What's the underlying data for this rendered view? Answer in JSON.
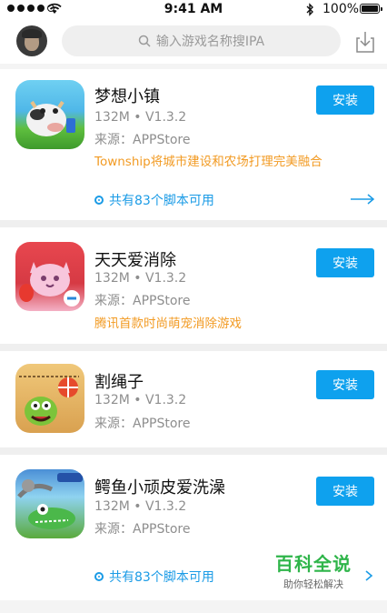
{
  "status_bar": {
    "time": "9:41 AM",
    "battery": "100%"
  },
  "search": {
    "placeholder": "输入游戏名称搜IPA"
  },
  "apps": [
    {
      "name": "梦想小镇",
      "meta": "132M • V1.3.2",
      "source": "来源：APPStore",
      "desc": "Township将城市建设和农场打理完美融合",
      "install_label": "安装",
      "scripts": "共有83个脚本可用"
    },
    {
      "name": "天天爱消除",
      "meta": "132M • V1.3.2",
      "source": "来源：APPStore",
      "desc": "腾讯首款时尚萌宠消除游戏",
      "install_label": "安装"
    },
    {
      "name": "割绳子",
      "meta": "132M • V1.3.2",
      "source": "来源：APPStore",
      "install_label": "安装"
    },
    {
      "name": "鳄鱼小顽皮爱洗澡",
      "meta": "132M • V1.3.2",
      "source": "来源：APPStore",
      "install_label": "安装",
      "scripts": "共有83个脚本可用"
    }
  ],
  "watermark": {
    "title": "百科全说",
    "subtitle": "助你轻松解决"
  },
  "colors": {
    "accent": "#0ea1ee",
    "desc_orange": "#f29b24",
    "divider": "#efefef"
  },
  "icons": [
    "search-icon",
    "download-icon",
    "arrow-right-icon",
    "wifi-icon",
    "bluetooth-icon",
    "battery-icon"
  ]
}
